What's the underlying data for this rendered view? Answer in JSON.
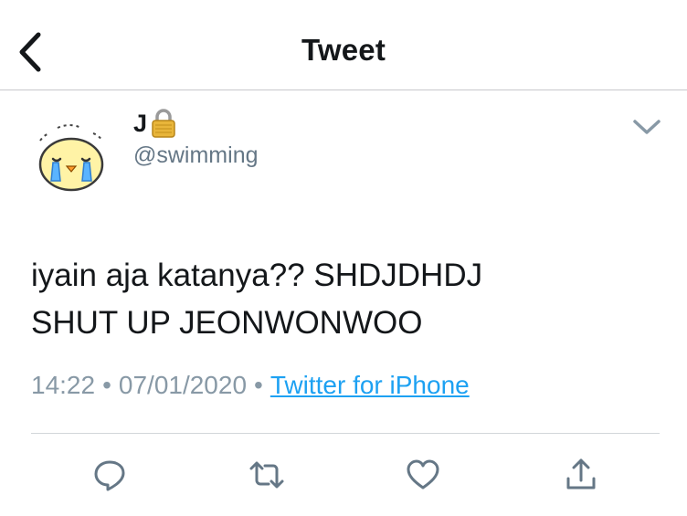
{
  "header": {
    "title": "Tweet",
    "back_icon": "chevron-left-icon"
  },
  "author": {
    "display_name": "J",
    "protected_icon": "lock-icon",
    "username": "@swimming",
    "avatar": "crying-chick-avatar"
  },
  "tweet": {
    "lines": [
      "iyain aja katanya?? SHDJDHDJ",
      "SHUT UP JEONWONWOO"
    ]
  },
  "meta": {
    "time": "14:22",
    "separator": "•",
    "date": "07/01/2020",
    "source": "Twitter for iPhone"
  },
  "actions": [
    {
      "name": "reply",
      "icon": "reply-icon"
    },
    {
      "name": "retweet",
      "icon": "retweet-icon"
    },
    {
      "name": "like",
      "icon": "heart-icon"
    },
    {
      "name": "share",
      "icon": "share-icon"
    }
  ],
  "colors": {
    "text": "#14171a",
    "secondary": "#657786",
    "meta": "#8899a6",
    "link": "#1da1f2",
    "icon": "#657786",
    "divider": "#d2d6da"
  }
}
